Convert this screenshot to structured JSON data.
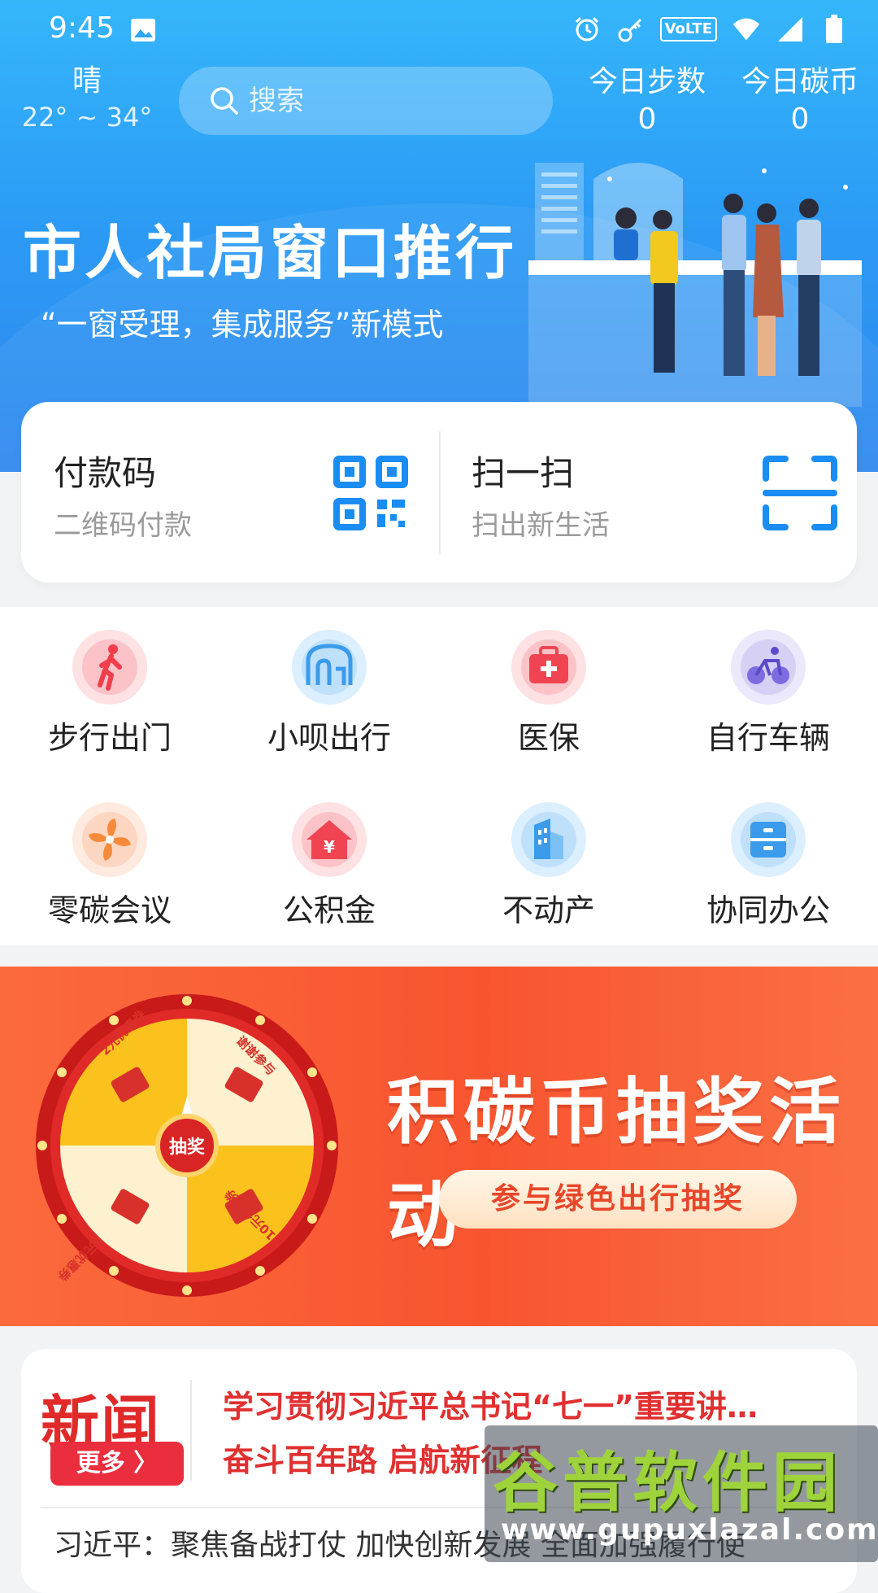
{
  "status_bar": {
    "time": "9:45",
    "volte_label": "VoLTE"
  },
  "header": {
    "weather": {
      "condition": "晴",
      "temp_range": "22° ~ 34°"
    },
    "search": {
      "placeholder": "搜索"
    },
    "stats": [
      {
        "label": "今日步数",
        "value": "0"
      },
      {
        "label": "今日碳币",
        "value": "0"
      }
    ]
  },
  "banner": {
    "title": "市人社局窗口推行",
    "subtitle": "“一窗受理，集成服务”新模式"
  },
  "pay_card": {
    "pay": {
      "title": "付款码",
      "subtitle": "二维码付款",
      "icon": "qr-code-icon"
    },
    "scan": {
      "title": "扫一扫",
      "subtitle": "扫出新生活",
      "icon": "scan-icon"
    }
  },
  "services": [
    {
      "label": "步行出门",
      "icon": "walking-icon",
      "color": "#fbd7da"
    },
    {
      "label": "小呗出行",
      "icon": "bus-icon",
      "color": "#d7ebfb"
    },
    {
      "label": "医保",
      "icon": "medical-kit-icon",
      "color": "#fbd7da"
    },
    {
      "label": "自行车辆",
      "icon": "bicycle-icon",
      "color": "#e4e1f8"
    },
    {
      "label": "零碳会议",
      "icon": "fan-icon",
      "color": "#fde4d8"
    },
    {
      "label": "公积金",
      "icon": "house-fund-icon",
      "color": "#fbd7da"
    },
    {
      "label": "不动产",
      "icon": "building-icon",
      "color": "#d7ebfb"
    },
    {
      "label": "协同办公",
      "icon": "cabinet-icon",
      "color": "#d7ebfb"
    }
  ],
  "lottery": {
    "title": "积碳币抽奖活动",
    "button": "参与绿色出行抽奖",
    "wheel_center": "抽奖",
    "segments": [
      "2元优惠券",
      "谢谢参与",
      "10元优惠券",
      "5元优惠券"
    ]
  },
  "news": {
    "logo": "新闻",
    "more": "更多 〉",
    "headlines": [
      "学习贯彻习近平总书记“七一”重要讲…",
      "奋斗百年路 启航新征程"
    ],
    "ticker": "习近平：聚焦备战打仗 加快创新发展 全面加强履行使"
  },
  "watermark": {
    "cn": "谷普软件园",
    "en": "www.gupuxlazal.com"
  },
  "colors": {
    "primary": "#2f94f2",
    "accent_red": "#e03030",
    "lottery_orange": "#f8552f"
  }
}
